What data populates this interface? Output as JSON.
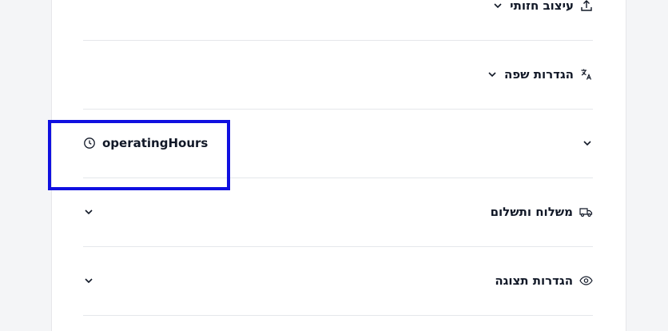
{
  "sections": [
    {
      "label": "עיצוב חזותי",
      "icon": "upload-icon"
    },
    {
      "label": "הגדרות שפה",
      "icon": "translate-icon"
    },
    {
      "label": "operatingHours",
      "icon": "clock-icon"
    },
    {
      "label": "משלוח ותשלום",
      "icon": "truck-icon"
    },
    {
      "label": "הגדרות תצוגה",
      "icon": "eye-icon"
    }
  ],
  "colors": {
    "highlight": "#1010e0",
    "text": "#111827",
    "divider": "#e5e7eb"
  }
}
